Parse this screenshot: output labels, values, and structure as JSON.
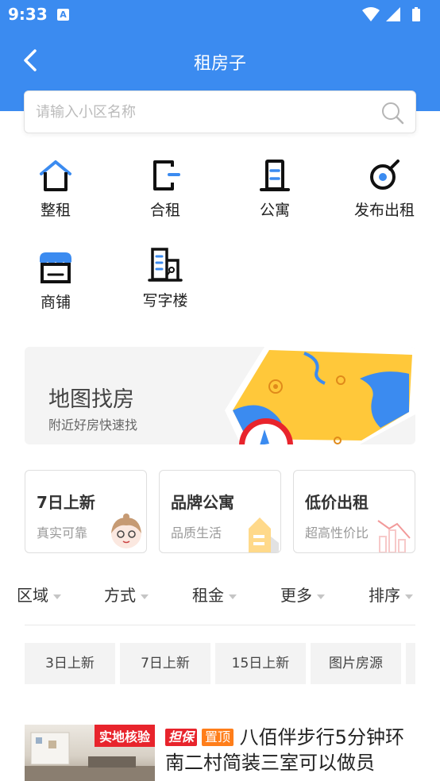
{
  "status_bar": {
    "time": "9:33",
    "notif_icon": "A"
  },
  "nav": {
    "title": "租房子"
  },
  "search": {
    "placeholder": "请输入小区名称"
  },
  "categories": [
    {
      "label": "整租",
      "icon": "house-icon"
    },
    {
      "label": "合租",
      "icon": "shared-room-icon"
    },
    {
      "label": "公寓",
      "icon": "apartment-icon"
    },
    {
      "label": "发布出租",
      "icon": "publish-icon"
    },
    {
      "label": "商铺",
      "icon": "shop-icon"
    },
    {
      "label": "写字楼",
      "icon": "office-building-icon"
    }
  ],
  "map_banner": {
    "title": "地图找房",
    "subtitle": "附近好房快速找"
  },
  "promo_cards": [
    {
      "title": "7日上新",
      "subtitle": "真实可靠"
    },
    {
      "title": "品牌公寓",
      "subtitle": "品质生活"
    },
    {
      "title": "低价出租",
      "subtitle": "超高性价比"
    }
  ],
  "filters": [
    "区域",
    "方式",
    "租金",
    "更多",
    "排序"
  ],
  "chips": [
    "3日上新",
    "7日上新",
    "15日上新",
    "图片房源"
  ],
  "listing": {
    "verified_badge": "实地核验",
    "guarantee_badge": "担保",
    "top_badge": "置顶",
    "title": "八佰伴步行5分钟环南二村简装三室可以做员"
  },
  "colors": {
    "primary": "#3b8bf0",
    "accent_red": "#e8242c",
    "accent_orange": "#ff7e1a",
    "map_yellow": "#ffc83a"
  }
}
